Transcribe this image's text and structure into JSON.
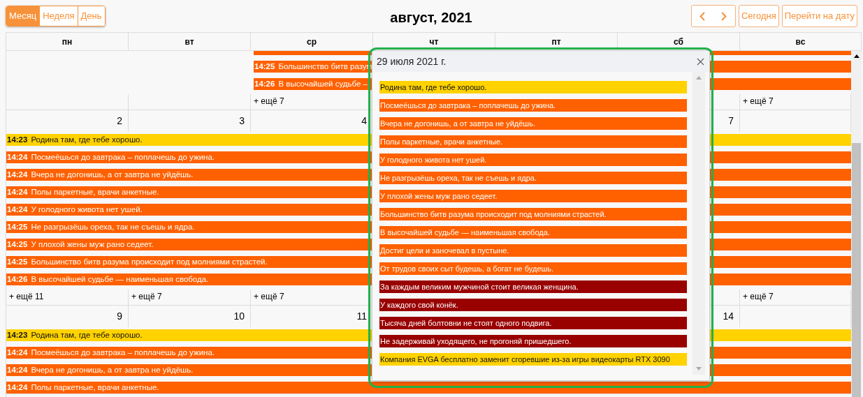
{
  "toolbar": {
    "views": [
      {
        "label": "Месяц",
        "selected": true
      },
      {
        "label": "Неделя",
        "selected": false
      },
      {
        "label": "День",
        "selected": false
      }
    ],
    "title": "август, 2021",
    "today": "Сегодня",
    "goto": "Перейти на дату"
  },
  "weekdays": [
    "пн",
    "вт",
    "ср",
    "чт",
    "пт",
    "сб",
    "вс"
  ],
  "weeks": [
    {
      "days": [
        {
          "kind": "empty"
        },
        {
          "kind": "empty"
        },
        {
          "kind": "day",
          "more": "+ ещё 7",
          "events": [
            {
              "color": "#ff6000"
            },
            {
              "time": "14:25",
              "title": "Большинство битв разум",
              "color": "#ff6000"
            },
            {
              "time": "14:26",
              "title": "В высочайшей судьбе –",
              "color": "#ff6000"
            }
          ]
        },
        {
          "kind": "empty"
        },
        {
          "kind": "empty"
        },
        {
          "kind": "empty"
        },
        {
          "kind": "day",
          "more": "+ ещё 7"
        }
      ]
    },
    {
      "days": [
        {
          "kind": "day",
          "number": "2",
          "more": "+ ещё 11",
          "events": [
            {
              "time": "14:23",
              "title": "Родина там, где тебе хорошо.",
              "color": "#ffd200"
            },
            {
              "time": "14:24",
              "title": "Посмеёшься до завтрака – поплачешь до ужина.",
              "color": "#ff6000"
            },
            {
              "time": "14:24",
              "title": "Вчера не догонишь, а от завтра не уйдёшь.",
              "color": "#ff6000"
            },
            {
              "time": "14:24",
              "title": "Полы паркетные, врачи анкетные.",
              "color": "#ff6000"
            },
            {
              "time": "14:24",
              "title": "У голодного живота нет ушей.",
              "color": "#ff6000"
            },
            {
              "time": "14:25",
              "title": "Не разгрызёшь ореха, так не съешь и ядра.",
              "color": "#ff6000"
            },
            {
              "time": "14:25",
              "title": "У плохой жены муж рано седеет.",
              "color": "#ff6000"
            },
            {
              "time": "14:25",
              "title": "Большинство битв разума происходит под молниями страстей.",
              "color": "#ff6000"
            },
            {
              "time": "14:26",
              "title": "В высочайшей судьбе — наименьшая свобода.",
              "color": "#ff6000"
            }
          ]
        },
        {
          "kind": "day",
          "number": "3",
          "more": "+ ещё 7"
        },
        {
          "kind": "day",
          "number": "4",
          "more": "+ ещё 7"
        },
        {
          "kind": "empty"
        },
        {
          "kind": "empty"
        },
        {
          "kind": "day",
          "number": "7"
        },
        {
          "kind": "day",
          "more": "+ ещё 7"
        }
      ]
    },
    {
      "days": [
        {
          "kind": "day",
          "number": "9",
          "events": [
            {
              "time": "14:23",
              "title": "Родина там, где тебе хорошо.",
              "color": "#ffd200"
            },
            {
              "time": "14:24",
              "title": "Посмеёшься до завтрака – поплачешь до ужина.",
              "color": "#ff6000"
            },
            {
              "time": "14:24",
              "title": "Вчера не догонишь, а от завтра не уйдёшь.",
              "color": "#ff6000"
            },
            {
              "time": "14:24",
              "title": "Полы паркетные, врачи анкетные.",
              "color": "#ff6000"
            }
          ]
        },
        {
          "kind": "day",
          "number": "10"
        },
        {
          "kind": "day",
          "number": "11"
        },
        {
          "kind": "empty"
        },
        {
          "kind": "empty"
        },
        {
          "kind": "day",
          "number": "14"
        },
        {
          "kind": "empty"
        }
      ]
    }
  ],
  "popover": {
    "title": "29 июля 2021 г.",
    "events": [
      {
        "title": "Родина там, где тебе хорошо.",
        "color": "#ffd200"
      },
      {
        "title": "Посмеёшься до завтрака – поплачешь до ужина.",
        "color": "#ff6000"
      },
      {
        "title": "Вчера не догонишь, а от завтра не уйдёшь.",
        "color": "#ff6000"
      },
      {
        "title": "Полы паркетные, врачи анкетные.",
        "color": "#ff6000"
      },
      {
        "title": "У голодного живота нет ушей.",
        "color": "#ff6000"
      },
      {
        "title": "Не разгрызёшь ореха, так не съешь и ядра.",
        "color": "#ff6000"
      },
      {
        "title": "У плохой жены муж рано седеет.",
        "color": "#ff6000"
      },
      {
        "title": "Большинство битв разума происходит под молниями страстей.",
        "color": "#ff6000"
      },
      {
        "title": "В высочайшей судьбе — наименьшая свобода.",
        "color": "#ff6000"
      },
      {
        "title": "Достиг цели и заночевал в пустыне.",
        "color": "#ff6000"
      },
      {
        "title": "От трудов своих сыт будешь, а богат не будешь.",
        "color": "#ff6000"
      },
      {
        "title": "За каждым великим мужчиной стоит великая женщина.",
        "color": "#990000"
      },
      {
        "title": "У каждого свой конёк.",
        "color": "#990000"
      },
      {
        "title": "Тысяча дней болтовни не стоят одного подвига.",
        "color": "#990000"
      },
      {
        "title": "Не задерживай уходящего, не прогоняй пришедшего.",
        "color": "#990000"
      },
      {
        "title": "Компания EVGA бесплатно заменит сгоревшие из-за игры видеокарты RTX 3090",
        "color": "#ffd200"
      }
    ]
  }
}
